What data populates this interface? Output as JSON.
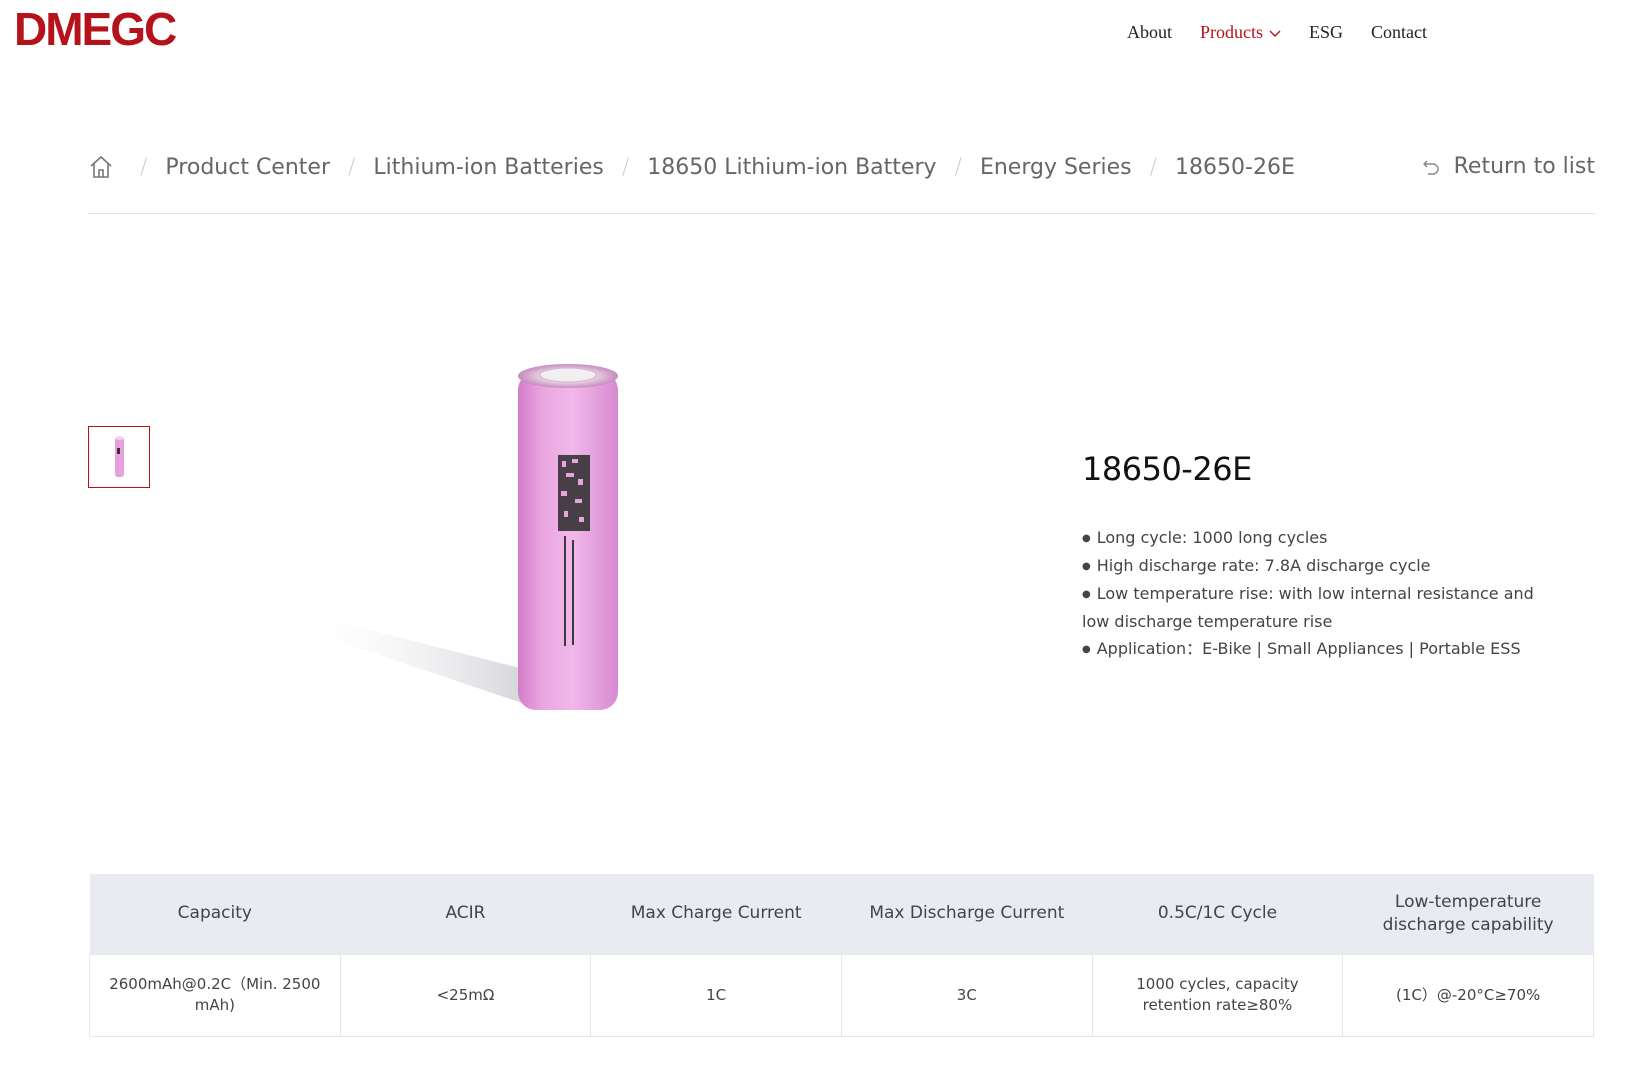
{
  "brand": {
    "logo_text": "DMEGC",
    "color": "#b5121b"
  },
  "nav": {
    "items": [
      {
        "label": "About"
      },
      {
        "label": "Products"
      },
      {
        "label": "ESG"
      },
      {
        "label": "Contact"
      }
    ]
  },
  "breadcrumb": {
    "items": [
      {
        "label": "Product Center"
      },
      {
        "label": "Lithium-ion Batteries"
      },
      {
        "label": "18650 Lithium-ion Battery"
      },
      {
        "label": "Energy Series"
      },
      {
        "label": "18650-26E"
      }
    ],
    "separator": "/",
    "return_label": "Return to list"
  },
  "product": {
    "title": "18650-26E",
    "features": [
      "Long cycle: 1000 long cycles",
      "High discharge rate: 7.8A discharge cycle",
      "Low temperature rise: with low internal resistance and low discharge temperature rise",
      "Application：E-Bike | Small Appliances | Portable ESS"
    ],
    "battery_color": "#e7a0dc"
  },
  "specs": {
    "headers": [
      "Capacity",
      "ACIR",
      "Max Charge Current",
      "Max Discharge Current",
      "0.5C/1C Cycle",
      "Low-temperature discharge capability"
    ],
    "rows": [
      [
        "2600mAh@0.2C（Min. 2500 mAh)",
        "<25mΩ",
        "1C",
        "3C",
        "1000 cycles, capacity retention rate≥80%",
        "(1C）@-20°C≥70%"
      ]
    ]
  }
}
